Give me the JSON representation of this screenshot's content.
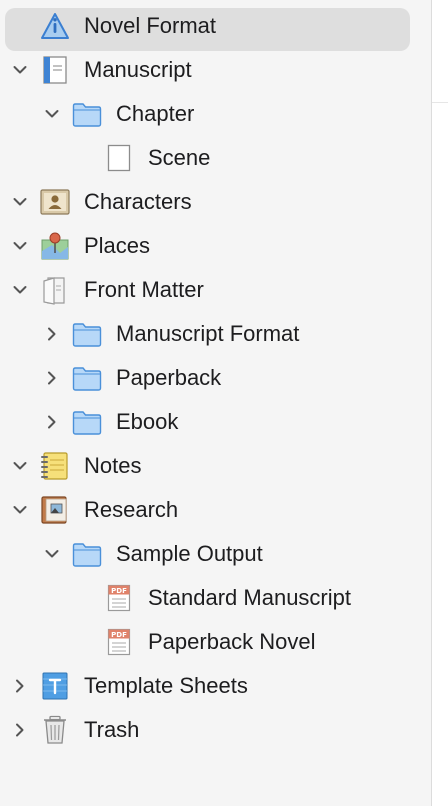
{
  "binder": {
    "items": [
      {
        "label": "Novel Format",
        "icon": "info-triangle-icon",
        "chevron": "none",
        "level": 0,
        "selected": true
      },
      {
        "label": "Manuscript",
        "icon": "manuscript-icon",
        "chevron": "down",
        "level": 0
      },
      {
        "label": "Chapter",
        "icon": "folder-icon",
        "chevron": "down",
        "level": 1
      },
      {
        "label": "Scene",
        "icon": "document-icon",
        "chevron": "none",
        "level": 2
      },
      {
        "label": "Characters",
        "icon": "person-card-icon",
        "chevron": "down",
        "level": 0
      },
      {
        "label": "Places",
        "icon": "map-pin-icon",
        "chevron": "down",
        "level": 0
      },
      {
        "label": "Front Matter",
        "icon": "front-matter-icon",
        "chevron": "down",
        "level": 0
      },
      {
        "label": "Manuscript Format",
        "icon": "folder-icon",
        "chevron": "right",
        "level": 1
      },
      {
        "label": "Paperback",
        "icon": "folder-icon",
        "chevron": "right",
        "level": 1
      },
      {
        "label": "Ebook",
        "icon": "folder-icon",
        "chevron": "right",
        "level": 1
      },
      {
        "label": "Notes",
        "icon": "notepad-icon",
        "chevron": "down",
        "level": 0
      },
      {
        "label": "Research",
        "icon": "research-icon",
        "chevron": "down",
        "level": 0
      },
      {
        "label": "Sample Output",
        "icon": "folder-icon",
        "chevron": "down",
        "level": 1
      },
      {
        "label": "Standard Manuscript",
        "icon": "pdf-icon",
        "chevron": "none",
        "level": 2
      },
      {
        "label": "Paperback Novel",
        "icon": "pdf-icon",
        "chevron": "none",
        "level": 2
      },
      {
        "label": "Template Sheets",
        "icon": "template-sheets-icon",
        "chevron": "right",
        "level": 0
      },
      {
        "label": "Trash",
        "icon": "trash-icon",
        "chevron": "right",
        "level": 0
      }
    ]
  },
  "colors": {
    "selection": "#dedede",
    "folder": "#b7d8f8",
    "folder_stroke": "#4a90d9",
    "chevron": "#555555",
    "text": "#1d1d1f"
  }
}
